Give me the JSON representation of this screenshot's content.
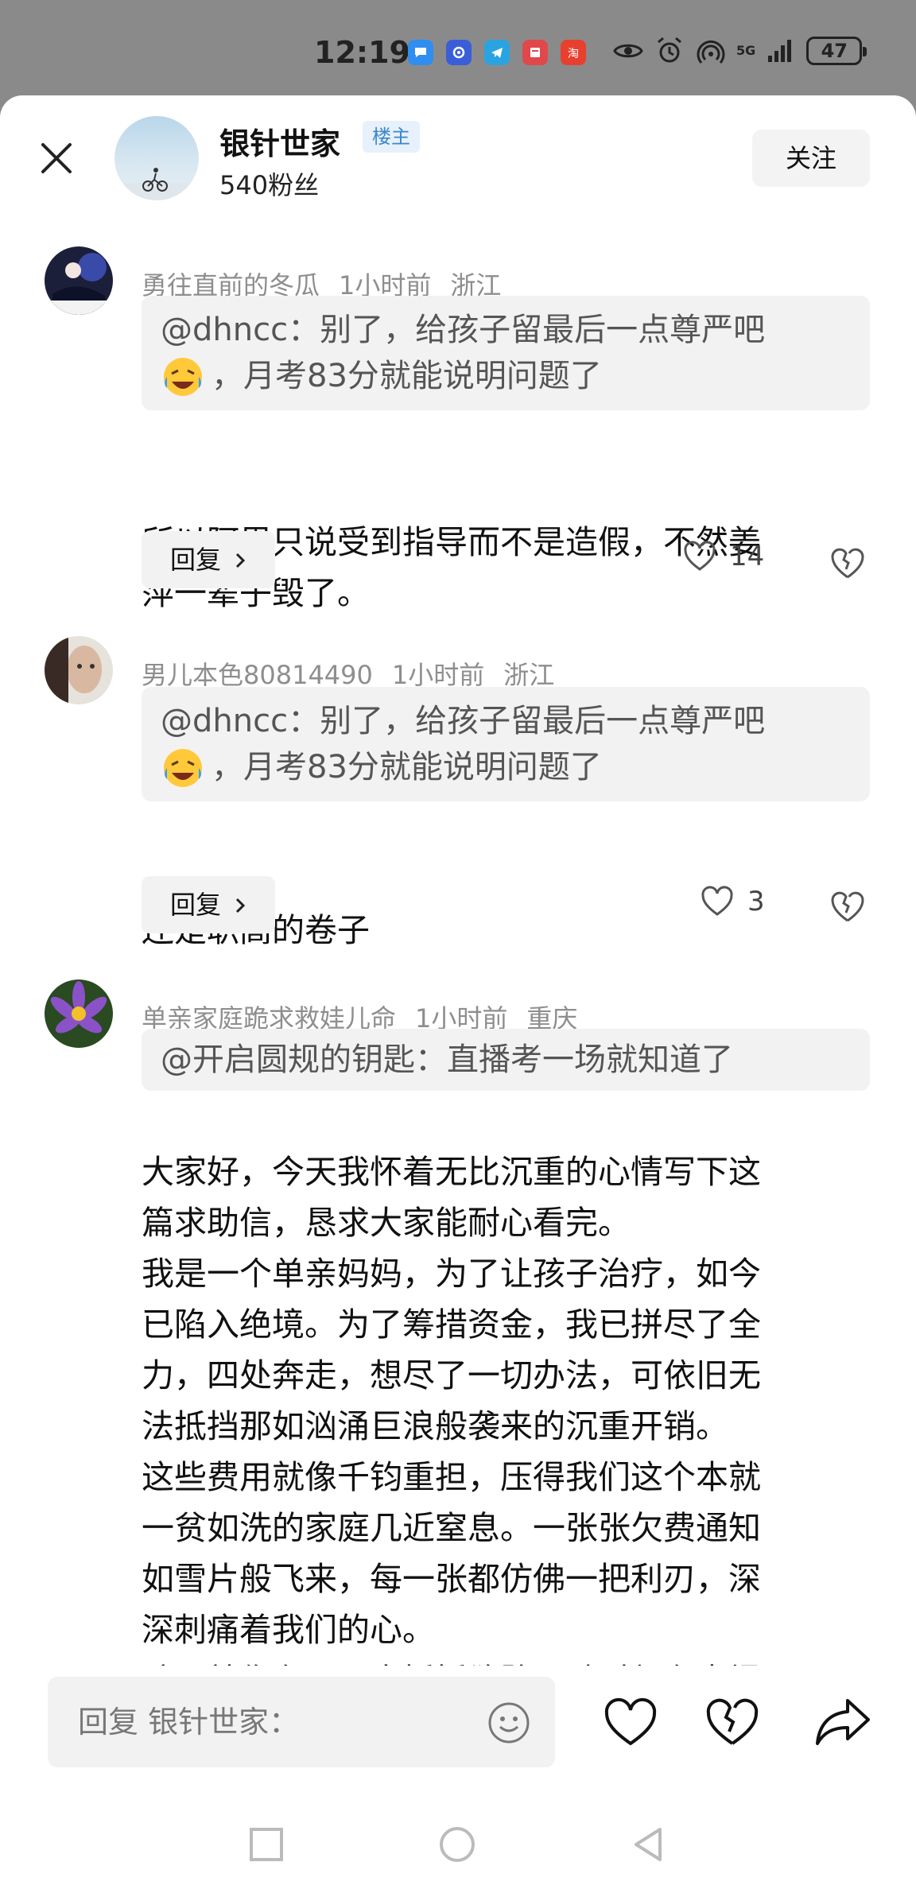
{
  "status_bar": {
    "time": "12:19",
    "network": "5G",
    "battery": "47",
    "icons": [
      "message-app-icon",
      "browser-app-icon",
      "telegram-app-icon",
      "book-app-icon",
      "taobao-app-icon",
      "eye-icon",
      "alarm-icon",
      "hotspot-icon",
      "signal-icon",
      "battery-icon"
    ]
  },
  "header": {
    "close_icon": "close-icon",
    "op_name": "银针世家",
    "op_badge": "楼主",
    "op_fans": "540粉丝",
    "follow_label": "关注"
  },
  "comments": [
    {
      "author": "勇往直前的冬瓜",
      "time": "1小时前",
      "location": "浙江",
      "quote_line1": "@dhncc：别了，给孩子留最后一点尊严吧",
      "quote_line2": "，月考83分就能说明问题了",
      "body_lines": [
        "所以阿里只说受到指导而不是造假，不然姜",
        "萍一辈子毁了。"
      ],
      "reply_label": "回复",
      "likes": "14"
    },
    {
      "author": "男儿本色80814490",
      "time": "1小时前",
      "location": "浙江",
      "quote_line1": "@dhncc：别了，给孩子留最后一点尊严吧",
      "quote_line2": "，月考83分就能说明问题了",
      "body_lines": [
        "还是职高的卷子"
      ],
      "reply_label": "回复",
      "likes": "3"
    },
    {
      "author": "单亲家庭跪求救娃儿命",
      "time": "1小时前",
      "location": "重庆",
      "quote_line1": "@开启圆规的钥匙：直播考一场就知道了",
      "body_lines": [
        "大家好，今天我怀着无比沉重的心情写下这",
        "篇求助信，恳求大家能耐心看完。",
        "我是一个单亲妈妈，为了让孩子治疗，如今",
        "已陷入绝境。为了筹措资金，我已拼尽了全",
        "力，四处奔走，想尽了一切办法，可依旧无",
        "法抵挡那如汹涌巨浪般袭来的沉重开销。",
        "这些费用就像千钧重担，压得我们这个本就",
        "一贫如洗的家庭几近窒息。一张张欠费通知",
        "如雪片般飞来，每一张都仿佛一把利刃，深",
        "深刺痛着我们的心。",
        "孩子就像在风雨中摇摇欲坠，随时都有崩塌"
      ]
    }
  ],
  "bottom_bar": {
    "input_placeholder": "回复 银针世家："
  },
  "colors": {
    "status_bar_bg": "#8a8a8a",
    "quote_bg": "#f2f2f2",
    "badge_bg": "#e6f1fb",
    "badge_text": "#3c86c9",
    "meta_text": "#8e8e8e"
  }
}
